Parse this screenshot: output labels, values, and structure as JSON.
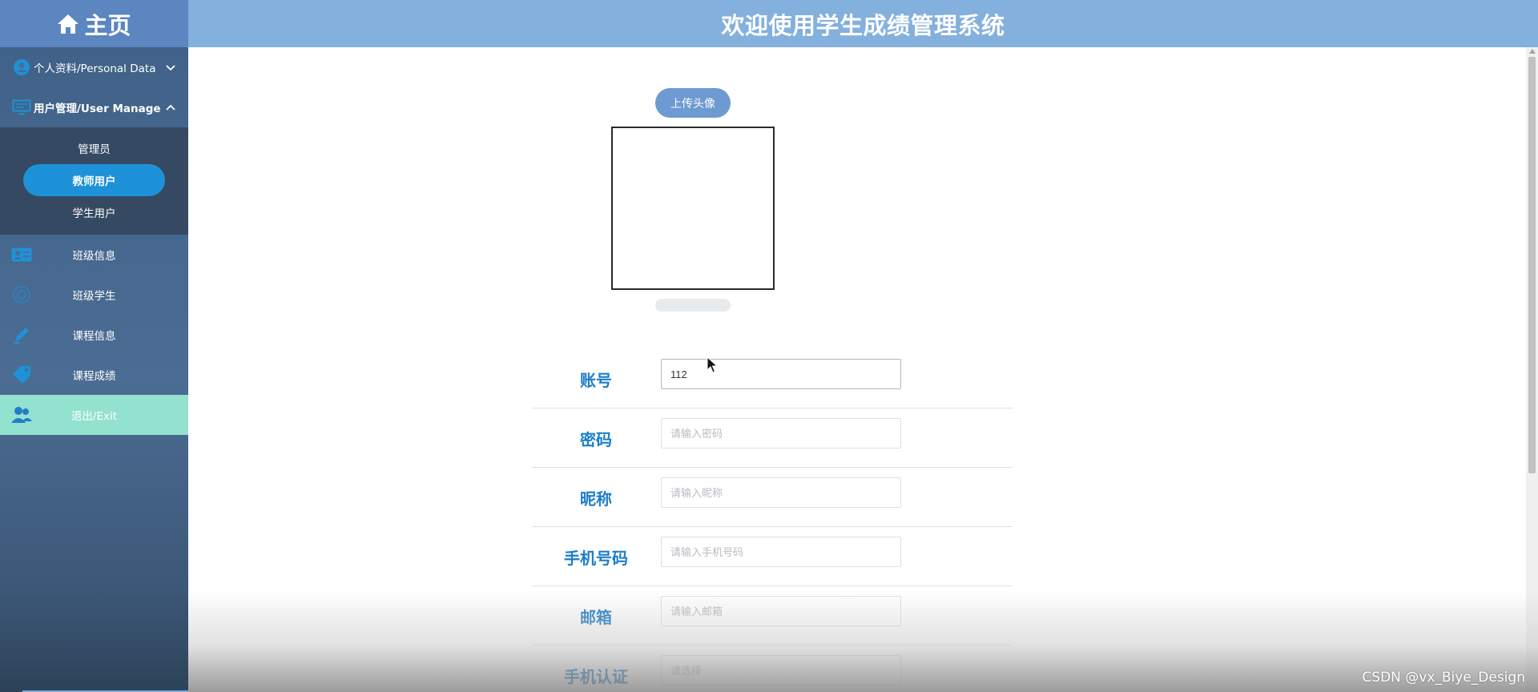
{
  "sidebar": {
    "brand": {
      "label": "主页",
      "icon": "home-icon"
    },
    "personal": {
      "label": "个人资料/Personal Data",
      "icon": "user-circle-icon"
    },
    "user_manage": {
      "label": "用户管理/User Manage",
      "icon": "monitor-icon",
      "items": [
        {
          "label": "管理员",
          "active": false
        },
        {
          "label": "教师用户",
          "active": true
        },
        {
          "label": "学生用户",
          "active": false
        }
      ]
    },
    "nav": [
      {
        "label": "班级信息",
        "icon": "id-card-icon"
      },
      {
        "label": "班级学生",
        "icon": "student-icon"
      },
      {
        "label": "课程信息",
        "icon": "pencil-icon"
      },
      {
        "label": "课程成绩",
        "icon": "tag-icon"
      }
    ],
    "exit": {
      "label": "退出/Exit",
      "icon": "users-icon"
    }
  },
  "header": {
    "title": "欢迎使用学生成绩管理系统"
  },
  "main": {
    "upload_button": "上传头像",
    "form": {
      "account": {
        "label": "账号",
        "value": "112",
        "placeholder": ""
      },
      "password": {
        "label": "密码",
        "value": "",
        "placeholder": "请输入密码"
      },
      "nickname": {
        "label": "昵称",
        "value": "",
        "placeholder": "请输入昵称"
      },
      "phone": {
        "label": "手机号码",
        "value": "",
        "placeholder": "请输入手机号码"
      },
      "email": {
        "label": "邮箱",
        "value": "",
        "placeholder": "请输入邮箱"
      },
      "phone_verify": {
        "label": "手机认证",
        "value": "",
        "placeholder": "请选择"
      }
    }
  },
  "watermark": "CSDN @vx_Biye_Design",
  "colors": {
    "header_bg": "#83b0dc",
    "brand_bg": "#5b86bf",
    "sidebar_bg": "#4b6c93",
    "active_item": "#1e92d8",
    "exit_bg": "#93e1cf",
    "label_blue": "#1e7ec8"
  }
}
